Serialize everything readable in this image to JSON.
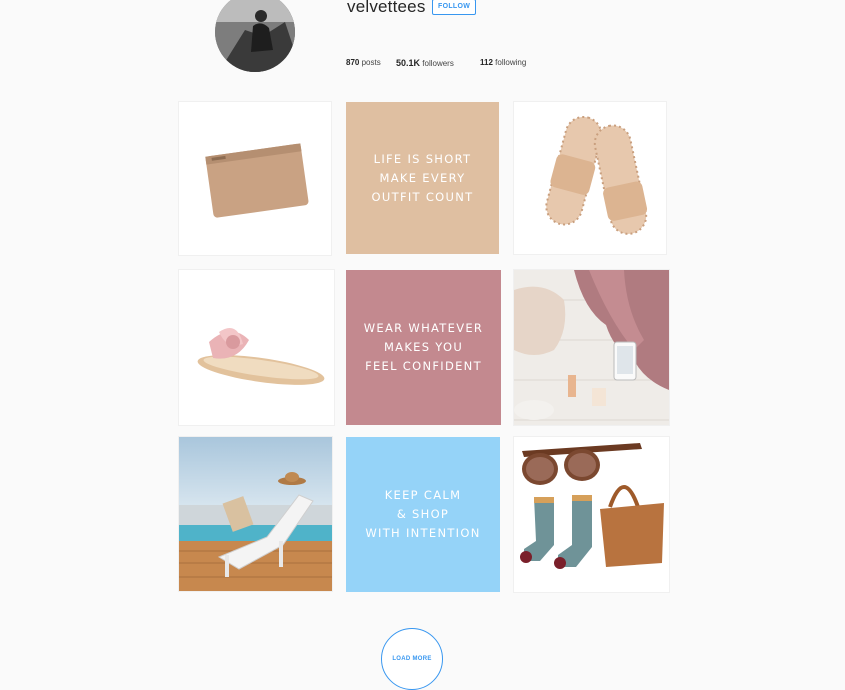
{
  "profile": {
    "username": "velvettees",
    "follow_label": "FOLLOW",
    "avatar_icon": "profile-photo"
  },
  "stats": {
    "posts_count": "870",
    "posts_label": "posts",
    "followers_count": "50.1K",
    "followers_label": "followers",
    "following_count": "112",
    "following_label": "following"
  },
  "grid": {
    "quote1": {
      "text": "LIFE IS SHORT\nMAKE EVERY\nOUTFIT COUNT",
      "bg": "#dfbfa1"
    },
    "quote2": {
      "text": "WEAR WHATEVER\nMAKES YOU\nFEEL CONFIDENT",
      "bg": "#c3898f"
    },
    "quote3": {
      "text": "KEEP CALM\n& SHOP\nWITH INTENTION",
      "bg": "#95d3f8"
    },
    "images": [
      "clutch-bag",
      "slide-sandals",
      "pink-bow-sandal",
      "flatlay-scarf-phone",
      "sun-lounger-pool",
      "sunglasses-socks-tote"
    ]
  },
  "load_more_label": "LOAD MORE",
  "colors": {
    "accent": "#3897f0",
    "background": "#fafafa"
  }
}
